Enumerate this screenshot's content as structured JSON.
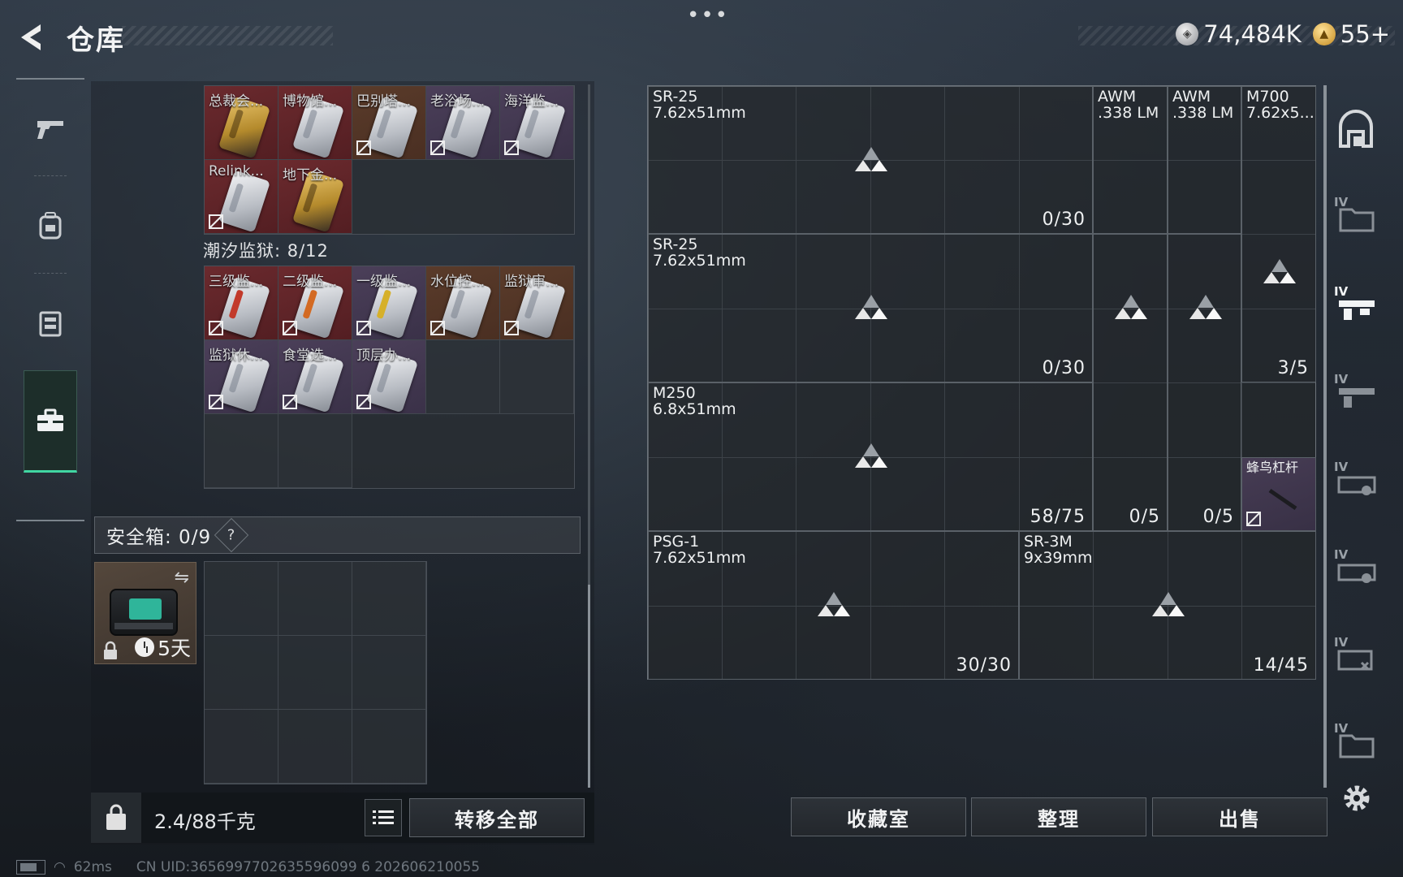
{
  "header": {
    "title": "仓库",
    "more": "•••",
    "currencies": [
      {
        "icon": "silver-coin-icon",
        "value": "74,484K"
      },
      {
        "icon": "gold-coin-icon",
        "value": "55+"
      }
    ]
  },
  "left_rail": {
    "items": [
      {
        "name": "weapons",
        "icon": "pistol-icon"
      },
      {
        "name": "armor",
        "icon": "backpack-icon"
      },
      {
        "name": "chest-rig",
        "icon": "vest-icon"
      },
      {
        "name": "keys",
        "icon": "toolbox-icon",
        "active": true
      }
    ]
  },
  "key_grid_1": {
    "cells": [
      {
        "label": "总裁会...",
        "bg": "red",
        "card": "gold",
        "lock": false
      },
      {
        "label": "博物馆...",
        "bg": "red",
        "card": "white",
        "lock": false
      },
      {
        "label": "巴别塔...",
        "bg": "orange",
        "card": "white",
        "lock": true
      },
      {
        "label": "老浴场...",
        "bg": "purple",
        "card": "white",
        "lock": true
      },
      {
        "label": "海洋监...",
        "bg": "purple",
        "card": "white",
        "lock": true
      },
      {
        "label": "Relink...",
        "bg": "red",
        "card": "white",
        "lock": true
      },
      {
        "label": "地下金...",
        "bg": "red",
        "card": "gold",
        "lock": false
      }
    ]
  },
  "prison": {
    "caption": "潮汐监狱: 8/12",
    "cells": [
      {
        "label": "三级监...",
        "bg": "red",
        "card": "white",
        "stripe": "red",
        "lock": true
      },
      {
        "label": "二级监...",
        "bg": "red",
        "card": "white",
        "stripe": "orange",
        "lock": true
      },
      {
        "label": "一级监...",
        "bg": "purple",
        "card": "white",
        "stripe": "yellow",
        "lock": true
      },
      {
        "label": "水位控...",
        "bg": "orange",
        "card": "white",
        "stripe": "none",
        "lock": true
      },
      {
        "label": "监狱审...",
        "bg": "orange",
        "card": "white",
        "stripe": "none",
        "lock": true
      },
      {
        "label": "监狱休...",
        "bg": "purple",
        "card": "white",
        "stripe": "none",
        "lock": true
      },
      {
        "label": "食堂选...",
        "bg": "purple",
        "card": "white",
        "stripe": "none",
        "lock": true
      },
      {
        "label": "顶层办...",
        "bg": "purple",
        "card": "white",
        "stripe": "none",
        "lock": true
      }
    ]
  },
  "safe": {
    "label": "安全箱: 0/9",
    "help": "?",
    "timer": "5天"
  },
  "bottom_left": {
    "weight": "2.4/88千克",
    "transfer_all": "转移全部"
  },
  "warehouse": {
    "items": [
      {
        "name": "SR-25\n7.62x51mm",
        "count": "0/30"
      },
      {
        "name": "AWM\n.338 LM",
        "count": ""
      },
      {
        "name": "AWM\n.338 LM",
        "count": ""
      },
      {
        "name": "M700\n7.62x5...",
        "count": ""
      },
      {
        "name": "SR-25\n7.62x51mm",
        "count": "0/30"
      },
      {
        "name": "",
        "count": "3/5"
      },
      {
        "name": "M250\n6.8x51mm",
        "count": "58/75"
      },
      {
        "name": "",
        "count": "0/5"
      },
      {
        "name": "",
        "count": "0/5"
      },
      {
        "name": "蜂鸟杠杆",
        "count": ""
      },
      {
        "name": "PSG-1\n7.62x51mm",
        "count": "30/30"
      },
      {
        "name": "SR-3M\n9x39mm",
        "count": "14/45"
      }
    ]
  },
  "bottom_buttons": {
    "collection": "收藏室",
    "sort": "整理",
    "sell": "出售"
  },
  "right_rail": {
    "tier_labels": [
      "IV",
      "IV",
      "IV",
      "IV",
      "IV",
      "IV",
      "IV"
    ]
  },
  "status": {
    "ping": "62ms",
    "uid": "CN UID:3656997702635596099 6 202606210055"
  }
}
